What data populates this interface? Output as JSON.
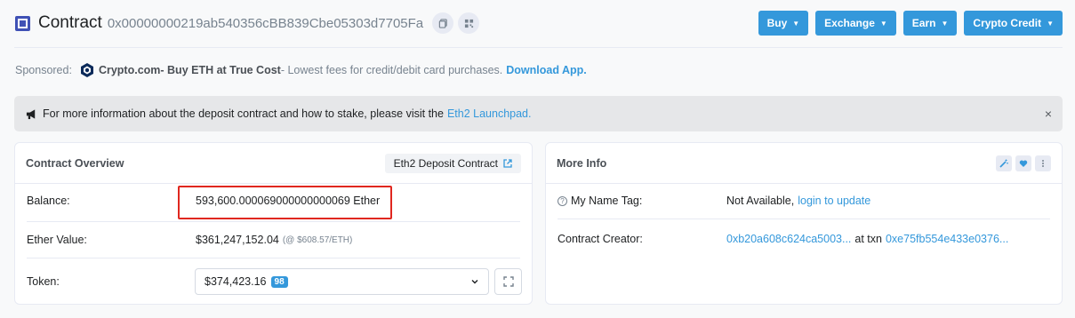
{
  "header": {
    "title": "Contract",
    "address": "0x00000000219ab540356cBB839Cbe05303d7705Fa",
    "buttons": [
      "Buy",
      "Exchange",
      "Earn",
      "Crypto Credit"
    ]
  },
  "sponsored": {
    "label": "Sponsored:",
    "brand": "Crypto.com",
    "headline": " - Buy ETH at True Cost",
    "text": " - Lowest fees for credit/debit card purchases.",
    "cta": "Download App."
  },
  "alert": {
    "text": "For more information about the deposit contract and how to stake, please visit the",
    "link": "Eth2 Launchpad.",
    "close": "×"
  },
  "overview": {
    "title": "Contract Overview",
    "tag": "Eth2 Deposit Contract",
    "balance_label": "Balance:",
    "balance_value": "593,600.000069000000000069 Ether",
    "ether_value_label": "Ether Value:",
    "ether_value": "$361,247,152.04",
    "ether_rate": "(@ $608.57/ETH)",
    "token_label": "Token:",
    "token_value": "$374,423.16",
    "token_count": "98"
  },
  "more_info": {
    "title": "More Info",
    "name_tag_label": "My Name Tag:",
    "name_tag_value": "Not Available,",
    "name_tag_link": "login to update",
    "creator_label": "Contract Creator:",
    "creator_address": "0xb20a608c624ca5003...",
    "creator_mid": "at txn",
    "creator_txn": "0xe75fb554e433e0376..."
  },
  "colors": {
    "accent": "#3498db",
    "highlight_border": "#e0271f"
  }
}
